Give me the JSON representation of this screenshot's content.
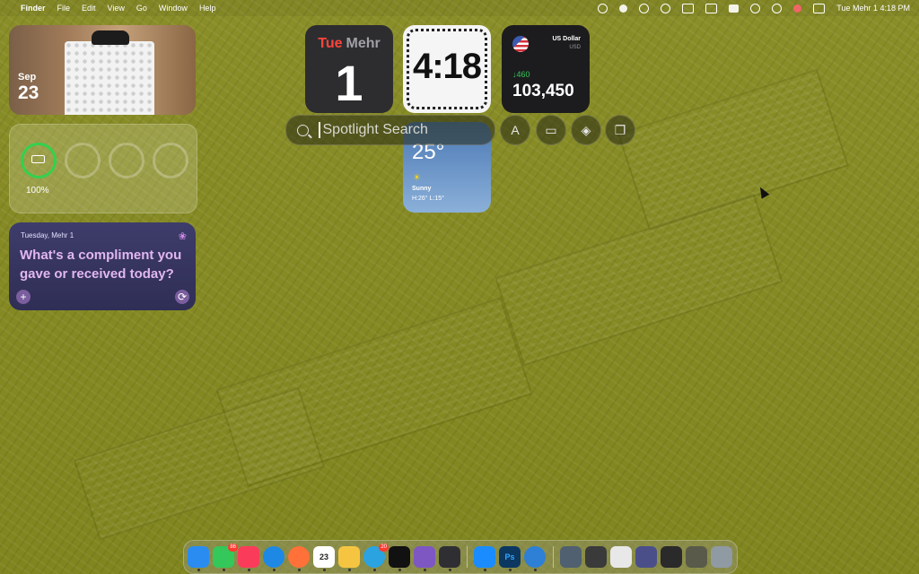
{
  "menubar": {
    "app_name": "Finder",
    "menus": [
      "File",
      "Edit",
      "View",
      "Go",
      "Window",
      "Help"
    ],
    "clock": "Tue Mehr 1  4:18 PM"
  },
  "widgets": {
    "photo": {
      "month": "Sep",
      "day": "23"
    },
    "batteries": {
      "percent": "100%"
    },
    "journal": {
      "date": "Tuesday, Mehr 1",
      "prompt": "What's a compliment you gave or received today?",
      "add_label": "+",
      "refresh_label": "⟳"
    },
    "calendar": {
      "weekday": "Tue",
      "month": "Mehr",
      "day": "1"
    },
    "clock": {
      "time": "4:18"
    },
    "stock": {
      "name": "US Dollar",
      "currency": "USD",
      "change": "↓460",
      "value": "103,450"
    },
    "weather": {
      "temp": "25°",
      "condition": "Sunny",
      "hilo": "H:26° L:15°"
    }
  },
  "spotlight": {
    "placeholder": "Spotlight Search"
  },
  "spotlight_buttons": [
    {
      "icon": "app-store-icon",
      "glyph": "A"
    },
    {
      "icon": "folder-icon",
      "glyph": "▭"
    },
    {
      "icon": "layers-icon",
      "glyph": "◈"
    },
    {
      "icon": "clipboard-icon",
      "glyph": "❐"
    }
  ],
  "dock": {
    "messages_badge": "86",
    "calendar_day": "23",
    "telegram_badge": "20",
    "ps_label": "Ps",
    "apps": [
      {
        "name": "finder",
        "color": "#2a8cf0"
      },
      {
        "name": "messages",
        "color": "#34c759"
      },
      {
        "name": "music",
        "color": "#fa3c5a"
      },
      {
        "name": "safari",
        "color": "#1e88e5"
      },
      {
        "name": "firefox",
        "color": "#ff7139"
      },
      {
        "name": "calendar",
        "color": "#ffffff"
      },
      {
        "name": "notes",
        "color": "#f5c542"
      },
      {
        "name": "telegram",
        "color": "#2aa3e0"
      },
      {
        "name": "terminal",
        "color": "#111111"
      },
      {
        "name": "feedback",
        "color": "#7e57c2"
      },
      {
        "name": "reminders",
        "color": "#2f2f33"
      },
      {
        "name": "app-store",
        "color": "#1a8cff"
      },
      {
        "name": "photoshop",
        "color": "#0b3760"
      },
      {
        "name": "quicktime",
        "color": "#2e7fd6"
      }
    ]
  }
}
